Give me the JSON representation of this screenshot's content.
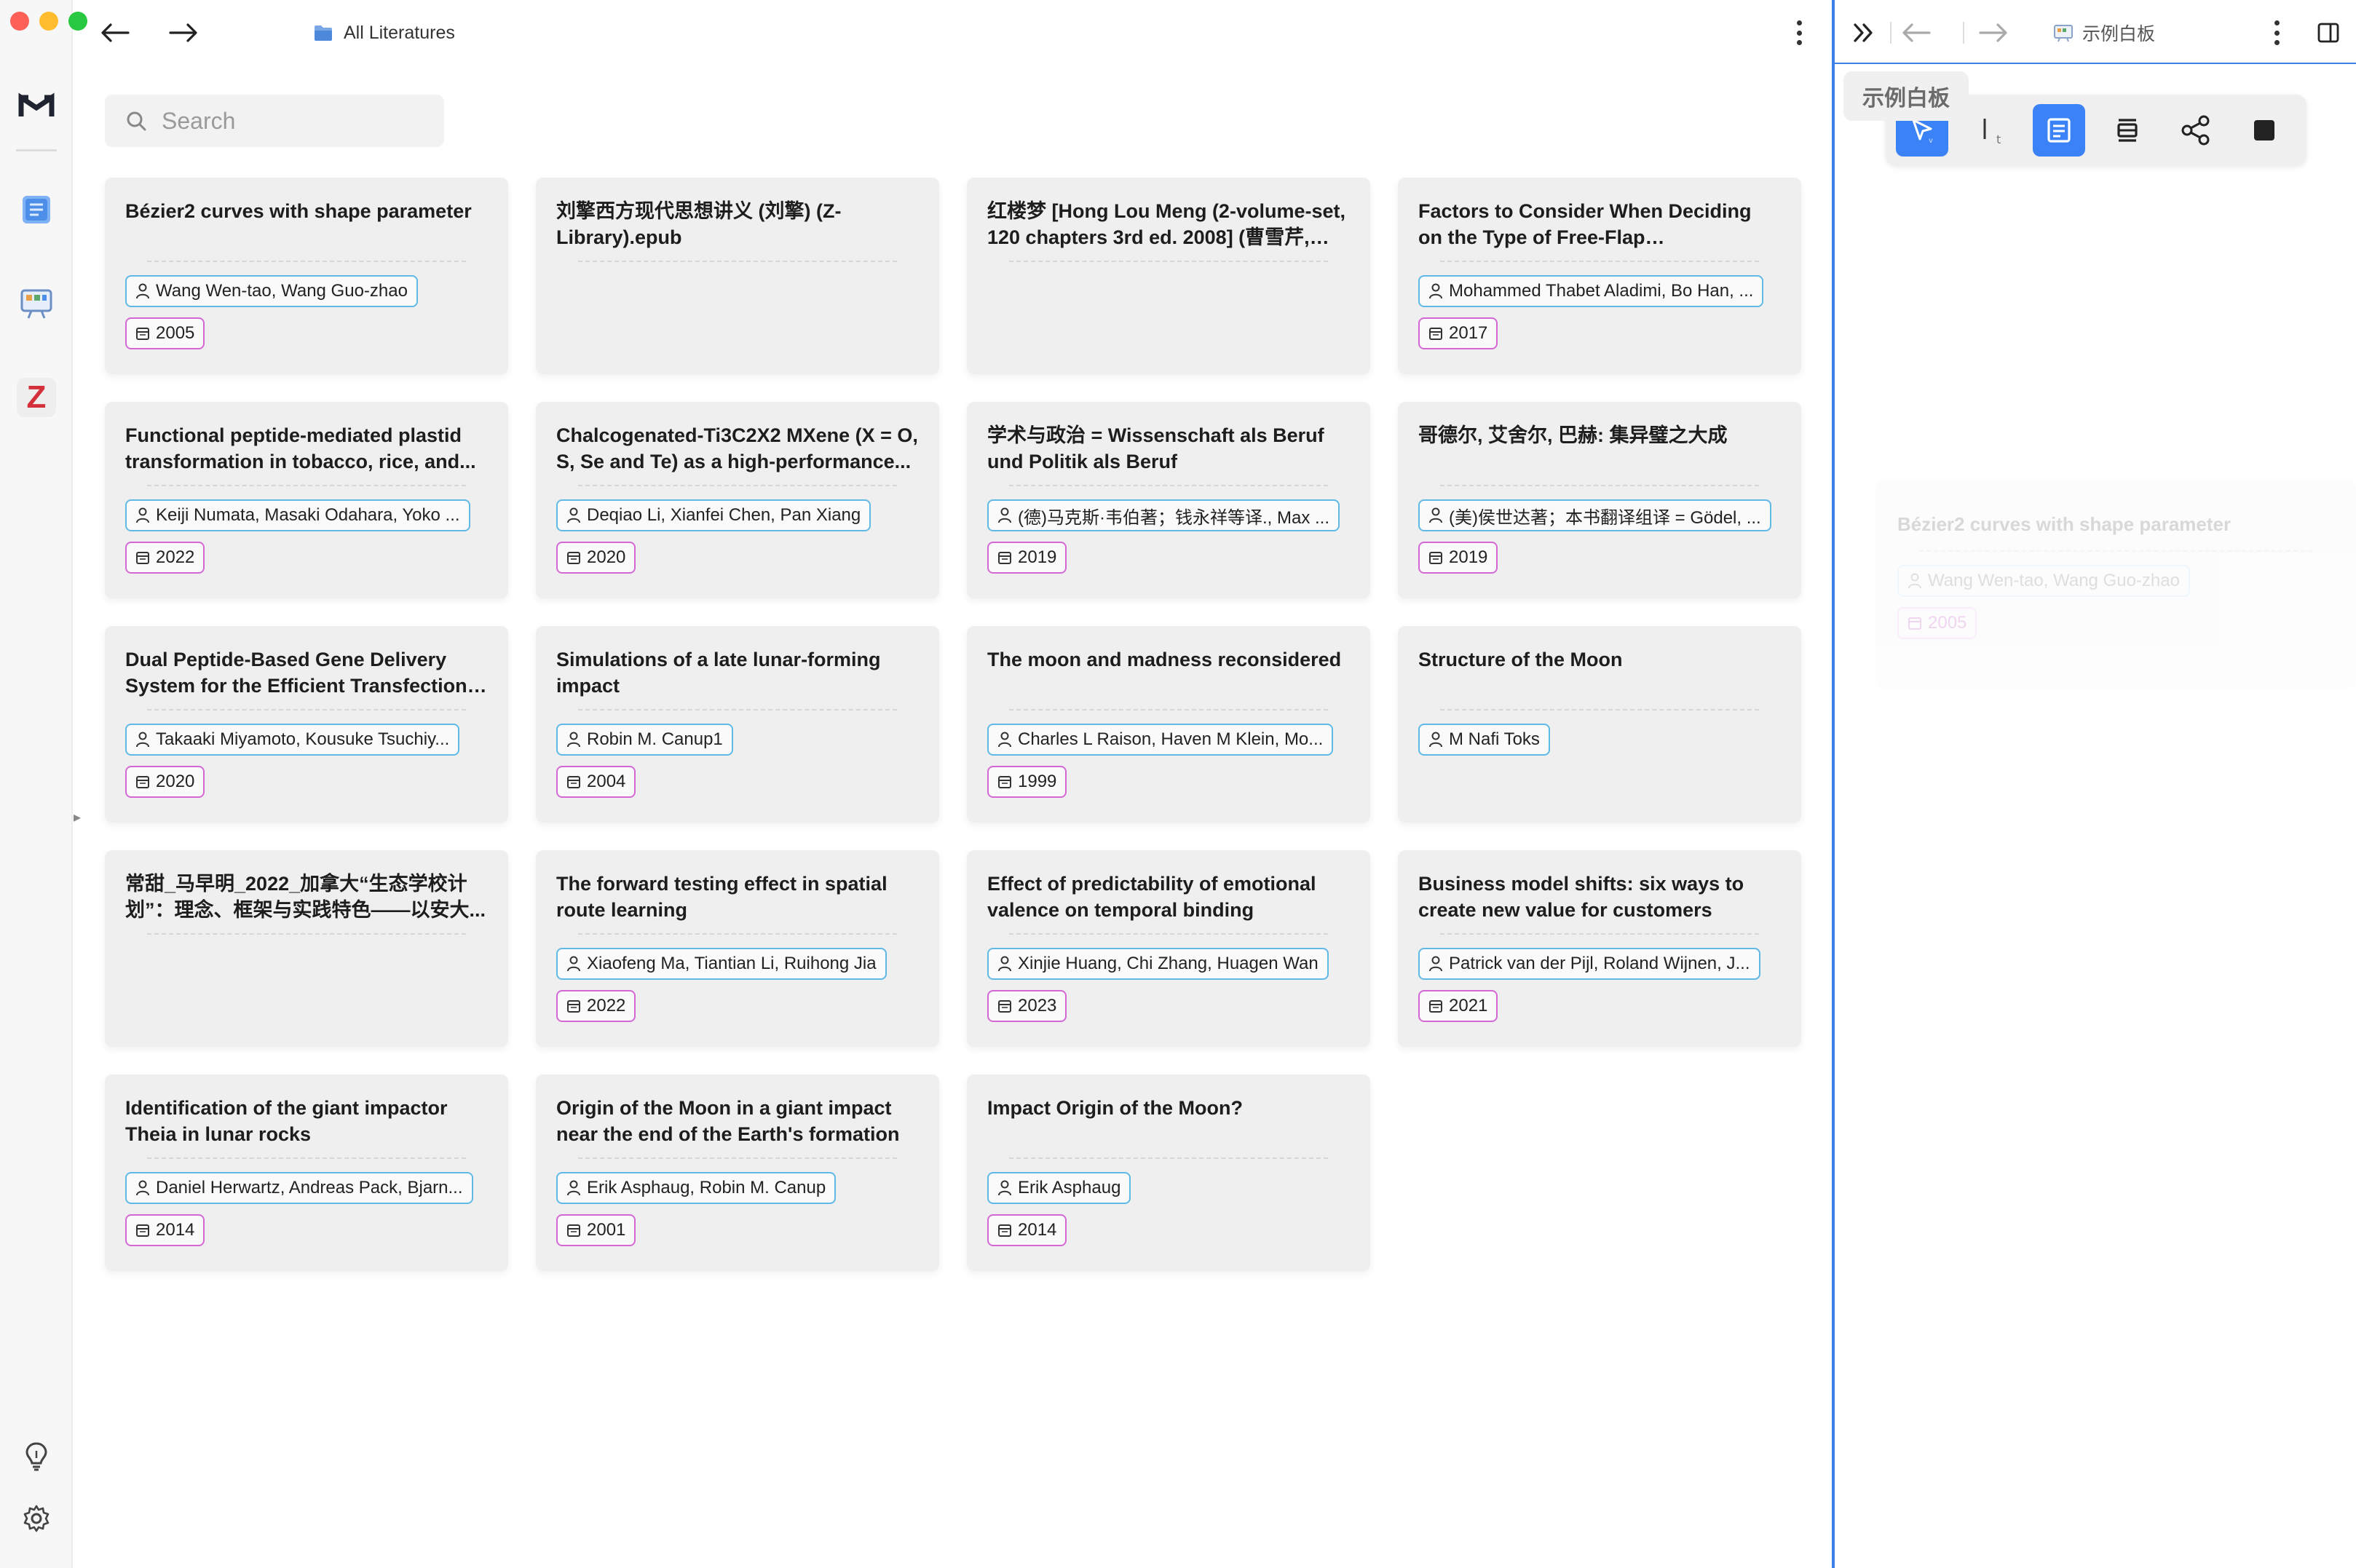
{
  "window": {
    "controls": [
      "close",
      "minimize",
      "zoom"
    ]
  },
  "rail": {
    "items": [
      {
        "name": "app-logo-icon",
        "icon": "m-logo"
      },
      {
        "name": "literature-icon",
        "icon": "book-icon"
      },
      {
        "name": "whiteboard-icon",
        "icon": "whiteboard-icon"
      },
      {
        "name": "zotero-icon",
        "icon": "zotero-z",
        "label": "Z"
      },
      {
        "name": "tips-icon",
        "icon": "lightbulb-icon"
      },
      {
        "name": "settings-icon",
        "icon": "gear-icon"
      }
    ]
  },
  "header": {
    "breadcrumb": "All Literatures"
  },
  "search": {
    "placeholder": "Search",
    "value": ""
  },
  "colors": {
    "accent": "#3b82f6",
    "authors_tag": "#5fb9e6",
    "year_tag": "#d667d8"
  },
  "cards": [
    {
      "title": "Bézier2 curves with shape parameter",
      "authors": "Wang Wen-tao, Wang Guo-zhao",
      "year": "2005"
    },
    {
      "title": "刘擎西方现代思想讲义 (刘擎) (Z-Library).epub",
      "authors": "",
      "year": ""
    },
    {
      "title": "红楼梦 [Hong Lou Meng (2-volume-set, 120 chapters 3rd ed. 2008] (曹雪芹, 高...",
      "authors": "",
      "year": ""
    },
    {
      "title": "Factors to Consider When Deciding on the Type of Free-Flap Reconstruction...",
      "authors": "Mohammed Thabet Aladimi, Bo Han, ...",
      "year": "2017"
    },
    {
      "title": "Functional peptide-mediated plastid transformation in tobacco, rice, and...",
      "authors": "Keiji Numata, Masaki Odahara, Yoko ...",
      "year": "2022"
    },
    {
      "title": "Chalcogenated-Ti3C2X2 MXene (X = O, S, Se and Te) as a high-performance...",
      "authors": "Deqiao Li, Xianfei Chen, Pan Xiang",
      "year": "2020"
    },
    {
      "title": "学术与政治 = Wissenschaft als Beruf und Politik als Beruf",
      "authors": "(德)马克斯·韦伯著；钱永祥等译., Max ...",
      "year": "2019"
    },
    {
      "title": "哥德尔, 艾舍尔, 巴赫: 集异璧之大成",
      "authors": "(美)侯世达著；本书翻译组译 = Gödel, ...",
      "year": "2019"
    },
    {
      "title": "Dual Peptide-Based Gene Delivery System for the Efficient Transfection ...",
      "authors": "Takaaki Miyamoto, Kousuke Tsuchiy...",
      "year": "2020"
    },
    {
      "title": "Simulations of a late lunar-forming impact",
      "authors": "Robin M. Canup1",
      "year": "2004"
    },
    {
      "title": "The moon and madness reconsidered",
      "authors": "Charles L Raison, Haven M Klein, Mo...",
      "year": "1999"
    },
    {
      "title": "Structure of the Moon",
      "authors": "M Nafi Toks",
      "year": ""
    },
    {
      "title": "常甜_马早明_2022_加拿大“生态学校计划”：理念、框架与实践特色——以安大...",
      "authors": "",
      "year": ""
    },
    {
      "title": "The forward testing effect in spatial route learning",
      "authors": "Xiaofeng Ma, Tiantian Li, Ruihong Jia",
      "year": "2022"
    },
    {
      "title": "Effect of predictability of emotional valence on temporal binding",
      "authors": "Xinjie Huang, Chi Zhang, Huagen Wan",
      "year": "2023"
    },
    {
      "title": "Business model shifts: six ways to create new value for customers",
      "authors": "Patrick van der Pijl, Roland Wijnen, J...",
      "year": "2021"
    },
    {
      "title": "Identification of the giant impactor Theia in lunar rocks",
      "authors": "Daniel Herwartz, Andreas Pack, Bjarn...",
      "year": "2014"
    },
    {
      "title": "Origin of the Moon in a giant impact near the end of the Earth's formation",
      "authors": "Erik Asphaug, Robin M. Canup",
      "year": "2001"
    },
    {
      "title": "Impact Origin of the Moon?",
      "authors": "Erik Asphaug",
      "year": "2014"
    }
  ],
  "right_panel": {
    "breadcrumb": "示例白板",
    "tab_label": "示例白板",
    "tools": [
      "select-tool",
      "text-tool",
      "card-tool",
      "stack-tool",
      "share-tool",
      "shape-tool"
    ],
    "active_tool": "card-tool",
    "ghost_card": {
      "title": "Bézier2 curves with shape parameter",
      "authors": "Wang Wen-tao, Wang Guo-zhao",
      "year": "2005"
    }
  }
}
